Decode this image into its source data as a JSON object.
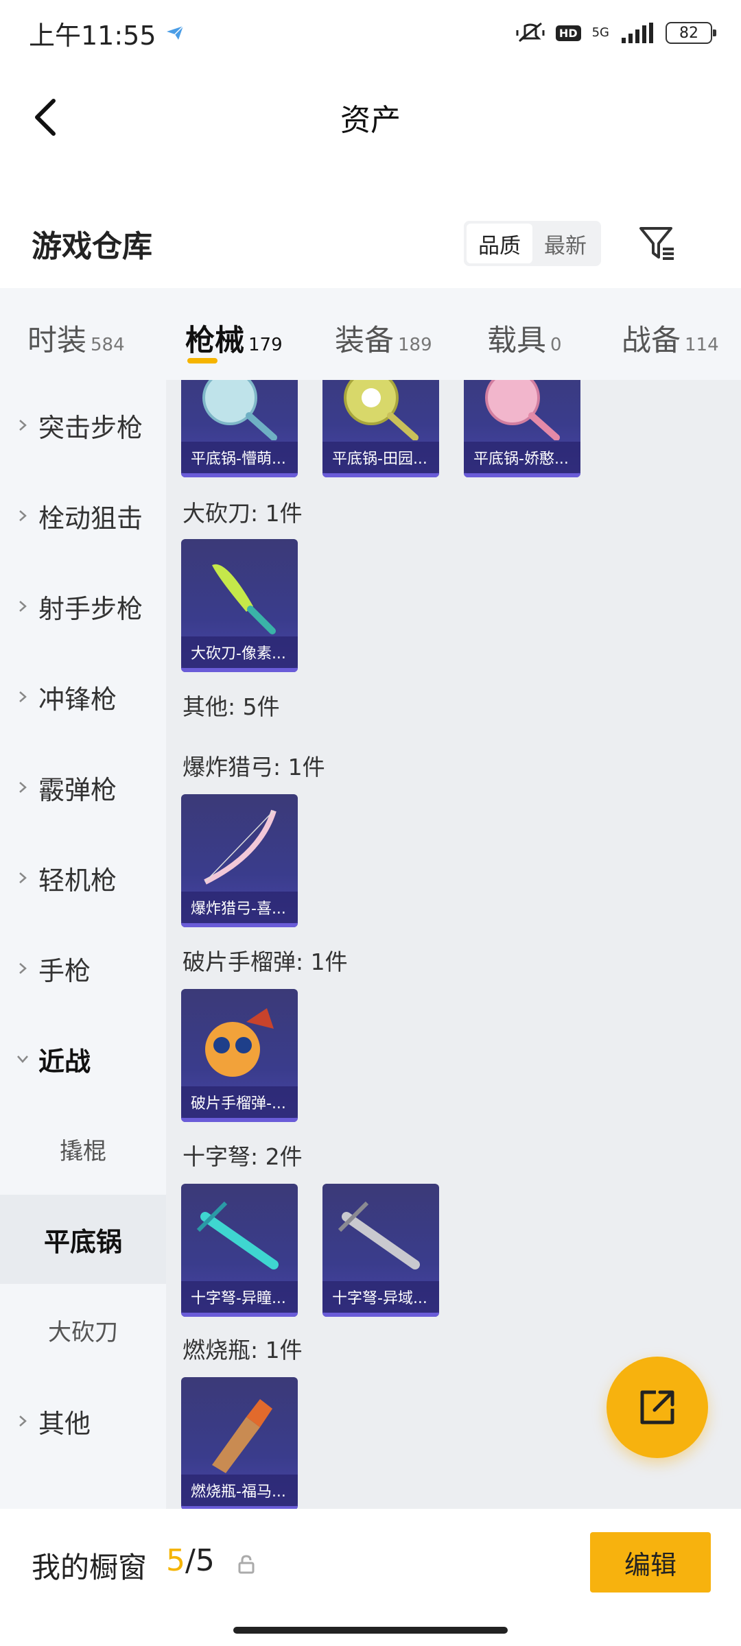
{
  "status": {
    "time": "上午11:55",
    "hd": "HD",
    "network": "5G",
    "battery": "82"
  },
  "header": {
    "title": "资产"
  },
  "section": {
    "title": "游戏仓库",
    "sort_options": [
      "品质",
      "最新"
    ]
  },
  "tabs": [
    {
      "name": "时装",
      "count": "584"
    },
    {
      "name": "枪械",
      "count": "179"
    },
    {
      "name": "装备",
      "count": "189"
    },
    {
      "name": "载具",
      "count": "0"
    },
    {
      "name": "战备",
      "count": "114"
    }
  ],
  "nav": {
    "items": [
      "突击步枪",
      "栓动狙击",
      "射手步枪",
      "冲锋枪",
      "霰弹枪",
      "轻机枪",
      "手枪",
      "近战"
    ],
    "subitems": [
      "撬棍",
      "平底锅",
      "大砍刀"
    ],
    "last": "其他"
  },
  "content": {
    "pans": [
      "平底锅-懵萌...",
      "平底锅-田园...",
      "平底锅-娇憨..."
    ],
    "machete_label": "大砍刀: 1件",
    "machete": [
      "大砍刀-像素..."
    ],
    "other_label": "其他: 5件",
    "bow_label": "爆炸猎弓: 1件",
    "bow": [
      "爆炸猎弓-喜..."
    ],
    "grenade_label": "破片手榴弹: 1件",
    "grenade": [
      "破片手榴弹-..."
    ],
    "crossbow_label": "十字弩: 2件",
    "crossbow": [
      "十字弩-异瞳...",
      "十字弩-异域..."
    ],
    "molotov_label": "燃烧瓶: 1件",
    "molotov": [
      "燃烧瓶-福马..."
    ]
  },
  "bottom": {
    "title": "我的橱窗",
    "current": "5",
    "total": "/5",
    "edit": "编辑"
  },
  "colors": {
    "accent": "#f5b400",
    "card": "#3b3a84"
  }
}
